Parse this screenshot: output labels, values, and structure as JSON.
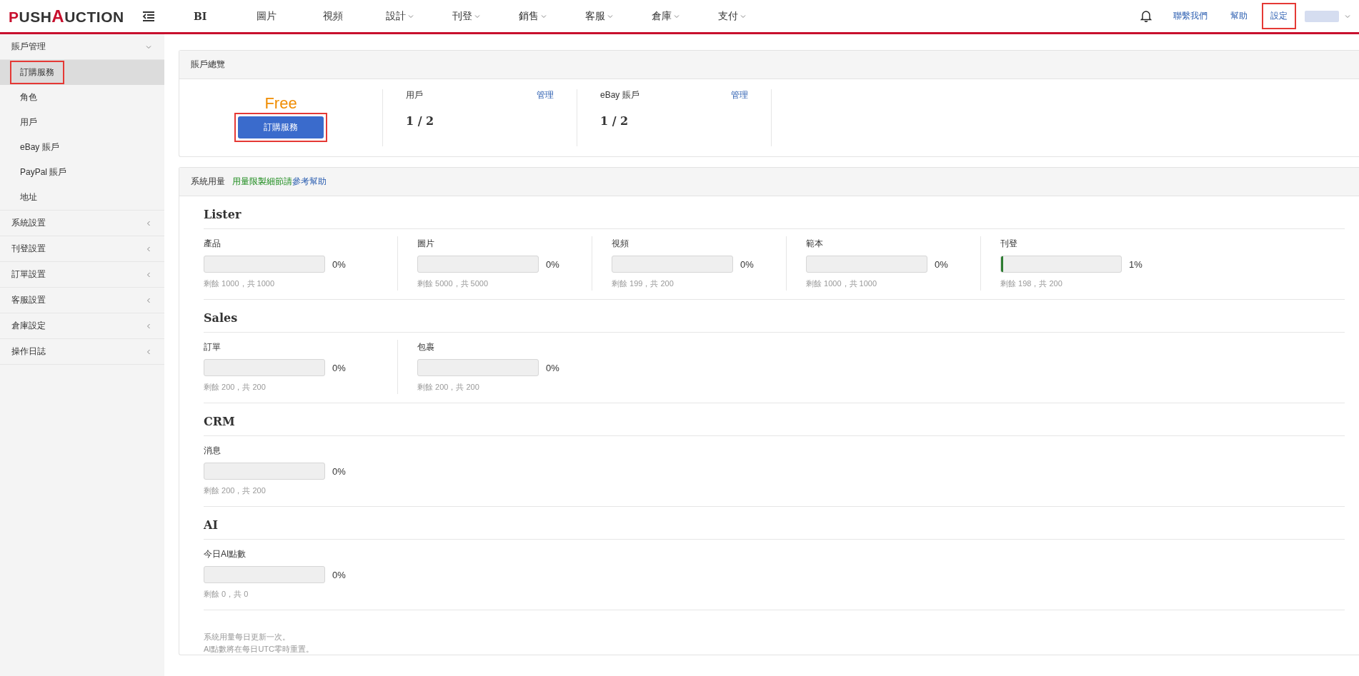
{
  "brand": {
    "name": "PUSHAUCTION"
  },
  "nav": [
    {
      "label": "BI",
      "dropdown": false,
      "kind": "bold"
    },
    {
      "label": "圖片",
      "dropdown": false,
      "kind": "plain"
    },
    {
      "label": "視頻",
      "dropdown": false,
      "kind": "plain"
    },
    {
      "label": "設計",
      "dropdown": true,
      "kind": "plain"
    },
    {
      "label": "刊登",
      "dropdown": true,
      "kind": "plain"
    },
    {
      "label": "銷售",
      "dropdown": true,
      "kind": "plain"
    },
    {
      "label": "客服",
      "dropdown": true,
      "kind": "plain"
    },
    {
      "label": "倉庫",
      "dropdown": true,
      "kind": "plain"
    },
    {
      "label": "支付",
      "dropdown": true,
      "kind": "plain"
    }
  ],
  "header_links": [
    {
      "label": "聯繫我們",
      "highlighted": false
    },
    {
      "label": "幫助",
      "highlighted": false
    },
    {
      "label": "設定",
      "highlighted": true
    }
  ],
  "sidebar": [
    {
      "label": "賬戶管理",
      "expanded": true,
      "children": [
        {
          "label": "訂購服務",
          "selected": true,
          "highlighted": true
        },
        {
          "label": "角色",
          "selected": false,
          "highlighted": false
        },
        {
          "label": "用戶",
          "selected": false,
          "highlighted": false
        },
        {
          "label": "eBay 賬戶",
          "selected": false,
          "highlighted": false
        },
        {
          "label": "PayPal 賬戶",
          "selected": false,
          "highlighted": false
        },
        {
          "label": "地址",
          "selected": false,
          "highlighted": false
        }
      ]
    },
    {
      "label": "系統設置",
      "expanded": false
    },
    {
      "label": "刊登設置",
      "expanded": false
    },
    {
      "label": "訂單設置",
      "expanded": false
    },
    {
      "label": "客服設置",
      "expanded": false
    },
    {
      "label": "倉庫設定",
      "expanded": false
    },
    {
      "label": "操作日誌",
      "expanded": false
    }
  ],
  "overview": {
    "title": "賬戶總覽",
    "plan": "Free",
    "subscribe_button": {
      "label": "訂購服務",
      "highlighted": true
    },
    "stats": [
      {
        "label": "用戶",
        "link": "管理",
        "value": "1 / 2"
      },
      {
        "label": "eBay 賬戶",
        "link": "管理",
        "value": "1 / 2"
      }
    ]
  },
  "usage": {
    "title": "系統用量",
    "hint": "用量限製細節請",
    "hint_link": "參考幫助",
    "sections": [
      {
        "title": "Lister",
        "items": [
          {
            "label": "產品",
            "level": 0,
            "percent": "0%",
            "remaining": "剩餘 1000，共 1000"
          },
          {
            "label": "圖片",
            "level": 0,
            "percent": "0%",
            "remaining": "剩餘 5000，共 5000"
          },
          {
            "label": "視頻",
            "level": 0,
            "percent": "0%",
            "remaining": "剩餘 199，共 200"
          },
          {
            "label": "範本",
            "level": 0,
            "percent": "0%",
            "remaining": "剩餘 1000，共 1000"
          },
          {
            "label": "刊登",
            "level": 0.01,
            "percent": "1%",
            "remaining": "剩餘 198，共 200"
          }
        ]
      },
      {
        "title": "Sales",
        "items": [
          {
            "label": "訂單",
            "level": 0,
            "percent": "0%",
            "remaining": "剩餘 200，共 200"
          },
          {
            "label": "包裹",
            "level": 0,
            "percent": "0%",
            "remaining": "剩餘 200，共 200"
          }
        ]
      },
      {
        "title": "CRM",
        "items": [
          {
            "label": "消息",
            "level": 0,
            "percent": "0%",
            "remaining": "剩餘 200，共 200"
          }
        ]
      },
      {
        "title": "AI",
        "items": [
          {
            "label": "今日AI點數",
            "level": 0,
            "percent": "0%",
            "remaining": "剩餘 0，共 0"
          }
        ]
      }
    ],
    "notes": [
      "系統用量每日更新一次。",
      "AI點數將在每日UTC零時重置。"
    ]
  }
}
